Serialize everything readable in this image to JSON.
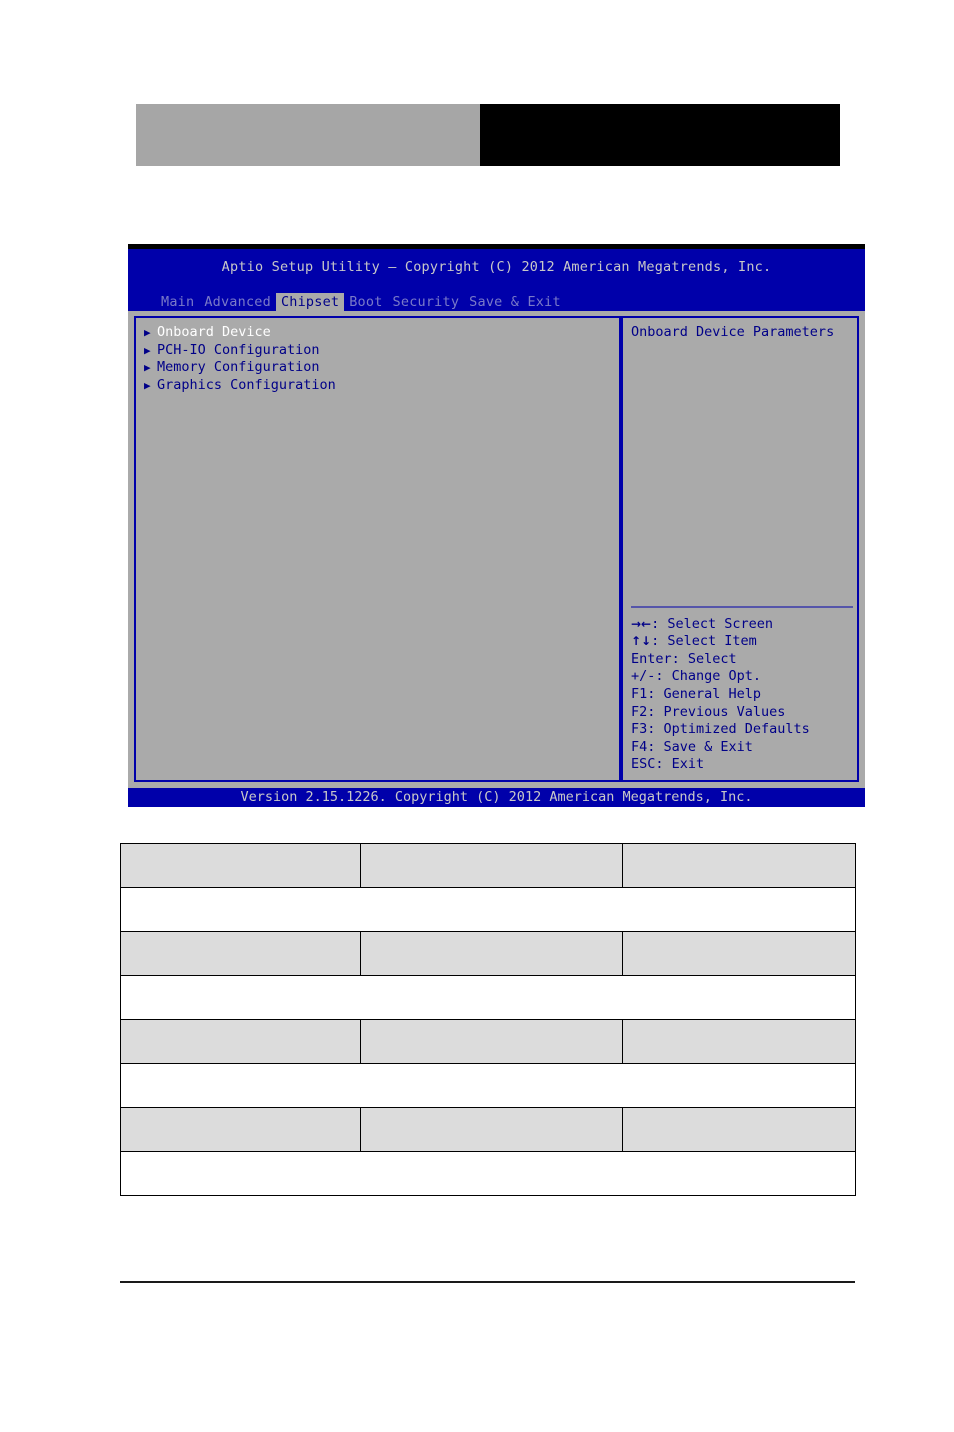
{
  "doc_header": {
    "left_block": "",
    "right_block": ""
  },
  "bios": {
    "title": "Aptio Setup Utility – Copyright (C) 2012 American Megatrends, Inc.",
    "menu_tabs": [
      {
        "label": "Main",
        "selected": false
      },
      {
        "label": "Advanced",
        "selected": false
      },
      {
        "label": "Chipset",
        "selected": true
      },
      {
        "label": "Boot",
        "selected": false
      },
      {
        "label": "Security",
        "selected": false
      },
      {
        "label": "Save & Exit",
        "selected": false
      }
    ],
    "menu_items": [
      {
        "arrow": "▶",
        "label": "Onboard Device",
        "selected": true
      },
      {
        "arrow": "▶",
        "label": "PCH-IO Configuration",
        "selected": false
      },
      {
        "arrow": "▶",
        "label": "Memory Configuration",
        "selected": false
      },
      {
        "arrow": "▶",
        "label": "Graphics Configuration",
        "selected": false
      }
    ],
    "help_text": "Onboard Device Parameters",
    "nav_keys": [
      {
        "glyph": "→←",
        "text": ": Select Screen"
      },
      {
        "glyph": "↑↓",
        "text": ": Select Item"
      },
      {
        "glyph": "",
        "text": "Enter: Select"
      },
      {
        "glyph": "",
        "text": "+/-: Change Opt."
      },
      {
        "glyph": "",
        "text": "F1: General Help"
      },
      {
        "glyph": "",
        "text": "F2: Previous Values"
      },
      {
        "glyph": "",
        "text": "F3: Optimized Defaults"
      },
      {
        "glyph": "",
        "text": "F4: Save & Exit"
      },
      {
        "glyph": "",
        "text": "ESC: Exit"
      }
    ],
    "footer": "Version 2.15.1226. Copyright (C) 2012 American Megatrends, Inc.",
    "colors": {
      "screen_blue": "#0000aa",
      "body_gray": "#aaaaaa",
      "text_blue": "#000088",
      "selected_white": "#ffffff",
      "title_text": "#c8c8c8"
    }
  },
  "doc_table": {
    "rows": [
      {
        "type": "header",
        "cells": [
          "",
          "",
          ""
        ]
      },
      {
        "type": "body",
        "cells": [
          ""
        ]
      },
      {
        "type": "header",
        "cells": [
          "",
          "",
          ""
        ]
      },
      {
        "type": "body",
        "cells": [
          ""
        ]
      },
      {
        "type": "header",
        "cells": [
          "",
          "",
          ""
        ]
      },
      {
        "type": "body",
        "cells": [
          ""
        ]
      },
      {
        "type": "header",
        "cells": [
          "",
          "",
          ""
        ]
      },
      {
        "type": "body",
        "cells": [
          ""
        ]
      }
    ]
  }
}
